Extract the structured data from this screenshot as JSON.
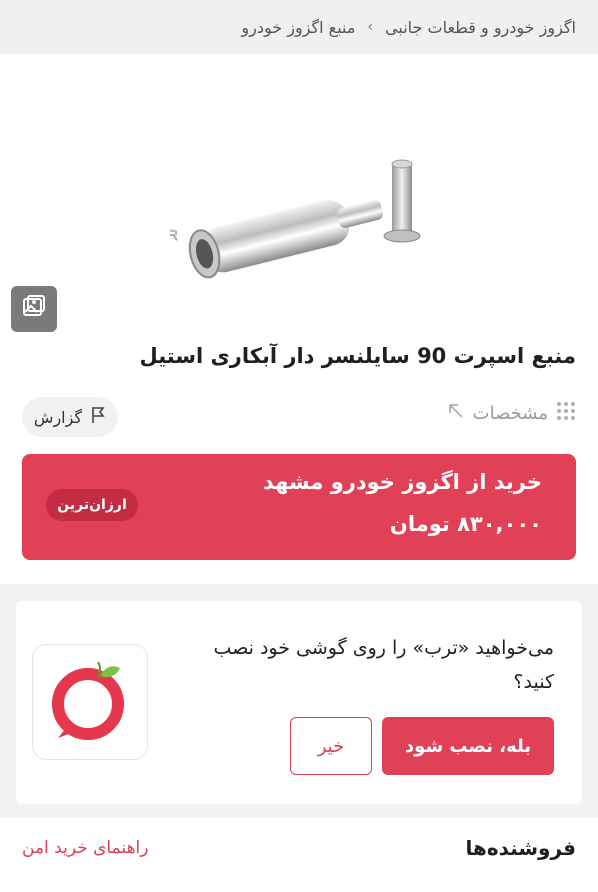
{
  "breadcrumb": {
    "items": [
      "اگزوز خودرو و قطعات جانبی",
      "منبع اگزوز خودرو"
    ],
    "separator": "›"
  },
  "product": {
    "image_watermark": "WWW.EGZOZKHODRO.IR",
    "title": "منبع اسپرت 90 سایلنسر دار آبکاری استیل",
    "specs_label": "مشخصات",
    "report_label": "گزارش"
  },
  "buy_box": {
    "title": "خرید از اگزوز خودرو مشهد",
    "price": "۸۳۰,۰۰۰ تومان",
    "badge": "ارزان‌ترین"
  },
  "app_banner": {
    "message": "می‌خواهید «ترب» را روی گوشی خود نصب کنید؟",
    "install_label": "بله، نصب شود",
    "dismiss_label": "خیر"
  },
  "sellers": {
    "title": "فروشنده‌ها",
    "guide_link": "راهنمای خرید امن"
  },
  "colors": {
    "accent": "#e04156",
    "badge": "#c32c42",
    "text": "#222222",
    "muted": "#9a9a9a"
  },
  "icons": [
    "gallery-icon",
    "grid-dots-icon",
    "expand-arrow-icon",
    "flag-icon",
    "torob-logo-icon"
  ]
}
